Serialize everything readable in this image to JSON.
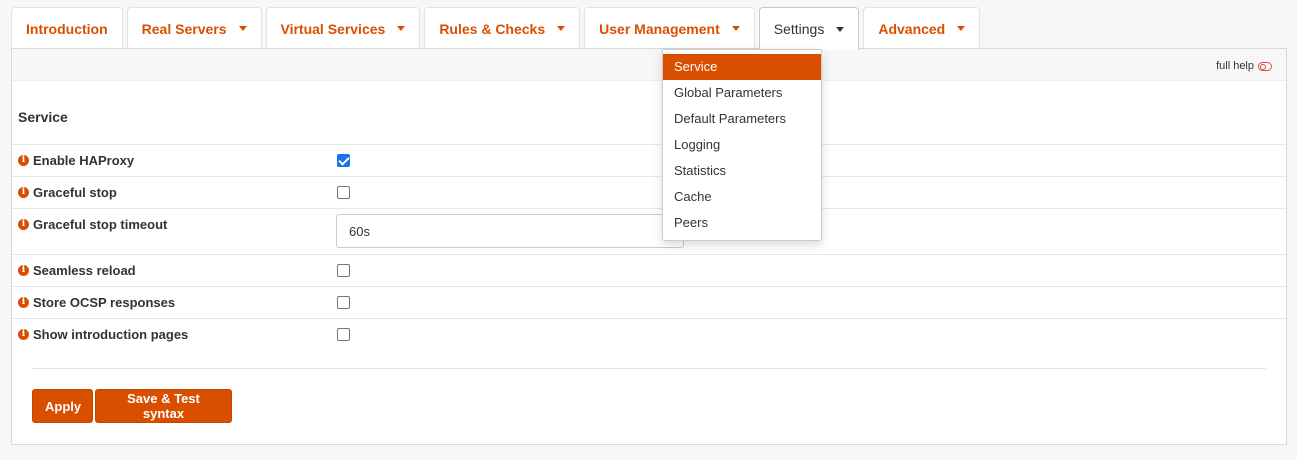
{
  "tabs": [
    {
      "label": "Introduction",
      "has_caret": false,
      "active": false
    },
    {
      "label": "Real Servers",
      "has_caret": true,
      "active": false
    },
    {
      "label": "Virtual Services",
      "has_caret": true,
      "active": false
    },
    {
      "label": "Rules & Checks",
      "has_caret": true,
      "active": false
    },
    {
      "label": "User Management",
      "has_caret": true,
      "active": false
    },
    {
      "label": "Settings",
      "has_caret": true,
      "active": true
    },
    {
      "label": "Advanced",
      "has_caret": true,
      "active": false
    }
  ],
  "dropdown": {
    "items": [
      "Service",
      "Global Parameters",
      "Default Parameters",
      "Logging",
      "Statistics",
      "Cache",
      "Peers"
    ],
    "selected": "Service"
  },
  "toolbar": {
    "full_help_label": "full help"
  },
  "section": {
    "title": "Service"
  },
  "fields": [
    {
      "label": "Enable HAProxy",
      "type": "checkbox",
      "checked": true
    },
    {
      "label": "Graceful stop",
      "type": "checkbox",
      "checked": false
    },
    {
      "label": "Graceful stop timeout",
      "type": "text",
      "value": "60s"
    },
    {
      "label": "Seamless reload",
      "type": "checkbox",
      "checked": false
    },
    {
      "label": "Store OCSP responses",
      "type": "checkbox",
      "checked": false
    },
    {
      "label": "Show introduction pages",
      "type": "checkbox",
      "checked": false
    }
  ],
  "buttons": {
    "apply_label": "Apply",
    "save_label": "Save & Test syntax"
  },
  "colors": {
    "accent": "#d94f00",
    "checkbox_checked": "#1a73e8"
  }
}
